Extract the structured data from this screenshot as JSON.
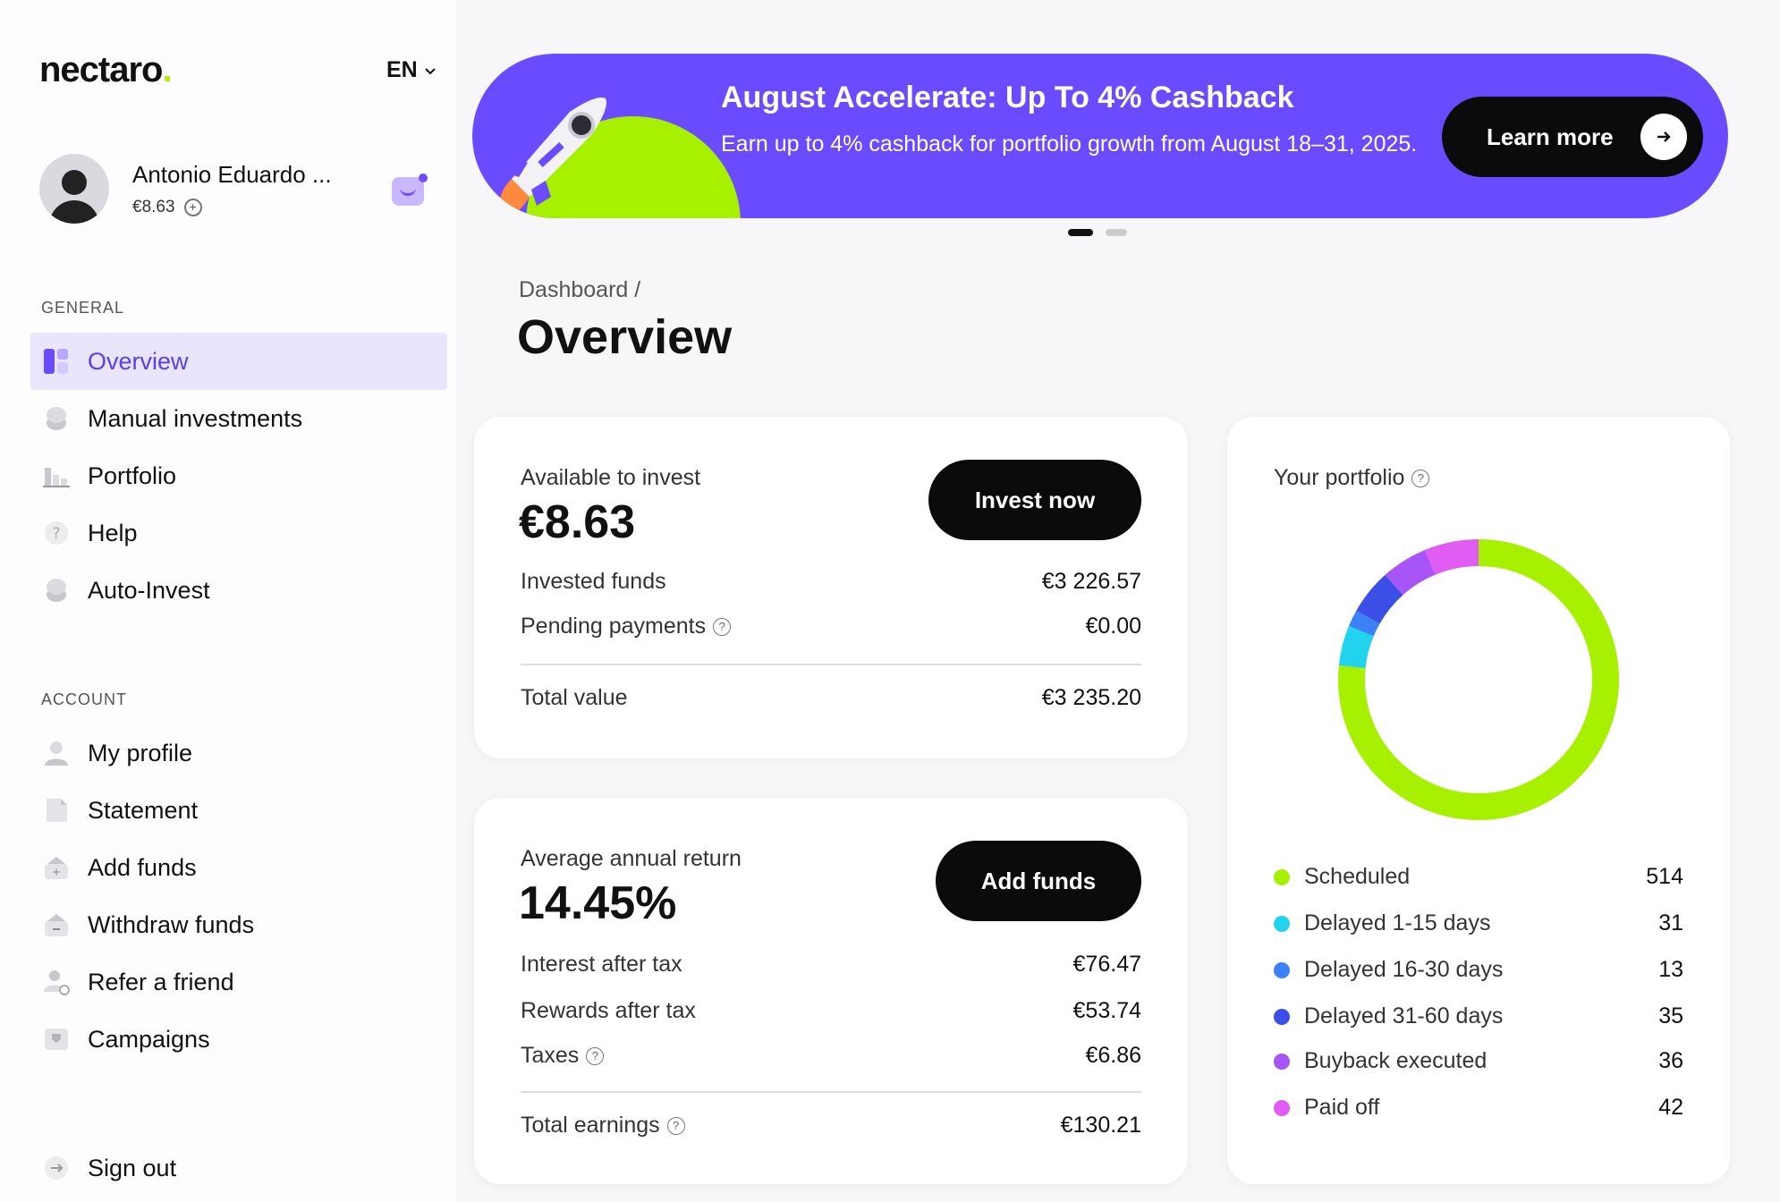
{
  "brand": {
    "logo_text": "nectaro",
    "logo_dot": ".",
    "accent": "#a6f000",
    "primary": "#6a4bff"
  },
  "language": {
    "current": "EN"
  },
  "user": {
    "name": "Antonio Eduardo ...",
    "balance": "€8.63"
  },
  "sidebar": {
    "general_label": "GENERAL",
    "general_items": [
      {
        "label": "Overview",
        "icon": "dashboard-icon",
        "active": true
      },
      {
        "label": "Manual investments",
        "icon": "coins-icon"
      },
      {
        "label": "Portfolio",
        "icon": "bar-chart-icon"
      },
      {
        "label": "Help",
        "icon": "question-icon"
      },
      {
        "label": "Auto-Invest",
        "icon": "coins-icon"
      }
    ],
    "account_label": "ACCOUNT",
    "account_items": [
      {
        "label": "My profile",
        "icon": "user-icon"
      },
      {
        "label": "Statement",
        "icon": "document-icon"
      },
      {
        "label": "Add funds",
        "icon": "wallet-plus-icon"
      },
      {
        "label": "Withdraw funds",
        "icon": "wallet-minus-icon"
      },
      {
        "label": "Refer a friend",
        "icon": "user-add-icon"
      },
      {
        "label": "Campaigns",
        "icon": "shield-icon"
      }
    ],
    "sign_out": "Sign out"
  },
  "banner": {
    "title": "August Accelerate: Up To 4% Cashback",
    "text": "Earn up to 4% cashback for portfolio growth from August 18–31, 2025.",
    "button": "Learn more"
  },
  "breadcrumb": "Dashboard /",
  "page_title": "Overview",
  "invest_card": {
    "available_label": "Available to invest",
    "available_value": "€8.63",
    "button": "Invest now",
    "rows": [
      {
        "label": "Invested funds",
        "value": "€3 226.57",
        "help": false
      },
      {
        "label": "Pending payments",
        "value": "€0.00",
        "help": true
      }
    ],
    "total_label": "Total value",
    "total_value": "€3 235.20"
  },
  "return_card": {
    "label": "Average annual return",
    "value": "14.45%",
    "button": "Add funds",
    "rows": [
      {
        "label": "Interest after tax",
        "value": "€76.47",
        "help": false
      },
      {
        "label": "Rewards after tax",
        "value": "€53.74",
        "help": false
      },
      {
        "label": "Taxes",
        "value": "€6.86",
        "help": true
      }
    ],
    "total_label": "Total earnings",
    "total_value": "€130.21"
  },
  "portfolio_card": {
    "title": "Your portfolio"
  },
  "chart_data": {
    "type": "pie",
    "title": "Your portfolio",
    "series": [
      {
        "name": "Scheduled",
        "value": 514,
        "color": "#a6f000"
      },
      {
        "name": "Delayed 1-15 days",
        "value": 31,
        "color": "#22d3ee"
      },
      {
        "name": "Delayed 16-30 days",
        "value": 13,
        "color": "#3b82f6"
      },
      {
        "name": "Delayed 31-60 days",
        "value": 35,
        "color": "#3b4fe6"
      },
      {
        "name": "Buyback executed",
        "value": 36,
        "color": "#a855f7"
      },
      {
        "name": "Paid off",
        "value": 42,
        "color": "#e05cf2"
      }
    ],
    "legend_placement": "bottom"
  }
}
